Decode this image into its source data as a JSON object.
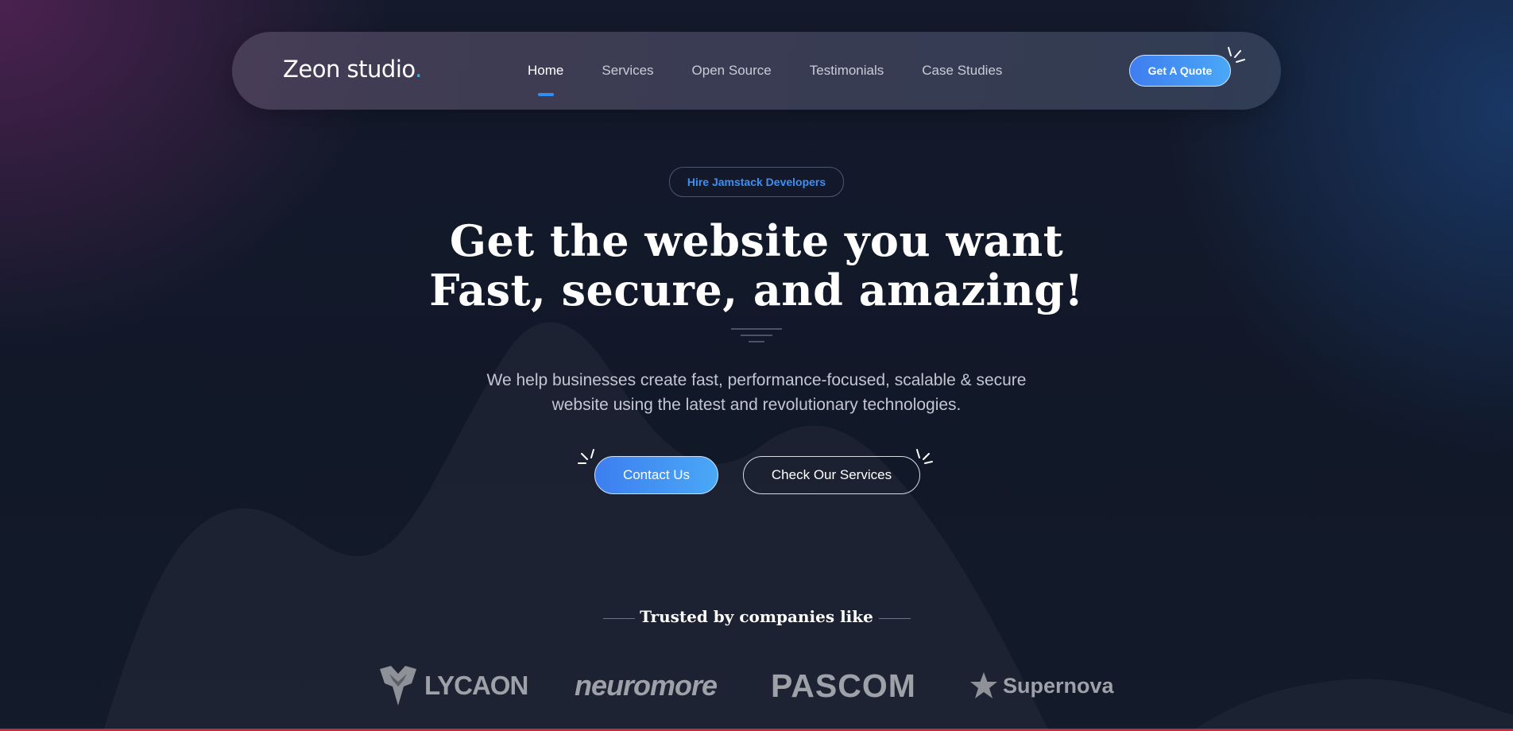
{
  "nav": {
    "logo_text": "Zeon studio",
    "logo_dot": ".",
    "items": [
      {
        "label": "Home",
        "active": true
      },
      {
        "label": "Services",
        "active": false
      },
      {
        "label": "Open Source",
        "active": false
      },
      {
        "label": "Testimonials",
        "active": false
      },
      {
        "label": "Case Studies",
        "active": false
      }
    ],
    "cta_label": "Get A Quote"
  },
  "hero": {
    "badge": "Hire Jamstack Developers",
    "headline_line1": "Get the website you want",
    "headline_line2": "Fast, secure, and amazing!",
    "subtitle_line1": "We help businesses create fast, performance-focused, scalable & secure",
    "subtitle_line2": "website using the latest and revolutionary technologies.",
    "primary_button": "Contact Us",
    "secondary_button": "Check Our Services"
  },
  "trusted": {
    "heading": "Trusted by companies like",
    "clients": [
      {
        "name": "LYCAON",
        "icon": "lycaon-logo-icon"
      },
      {
        "name": "neuromore",
        "icon": ""
      },
      {
        "name": "PASCOM",
        "icon": ""
      },
      {
        "name": "Supernova",
        "icon": "star-icon"
      }
    ]
  },
  "colors": {
    "accent": "#2f8ef5",
    "logo_dot": "#2ab6f0",
    "badge_text": "#3d8ff5",
    "background": "#141a2b"
  }
}
